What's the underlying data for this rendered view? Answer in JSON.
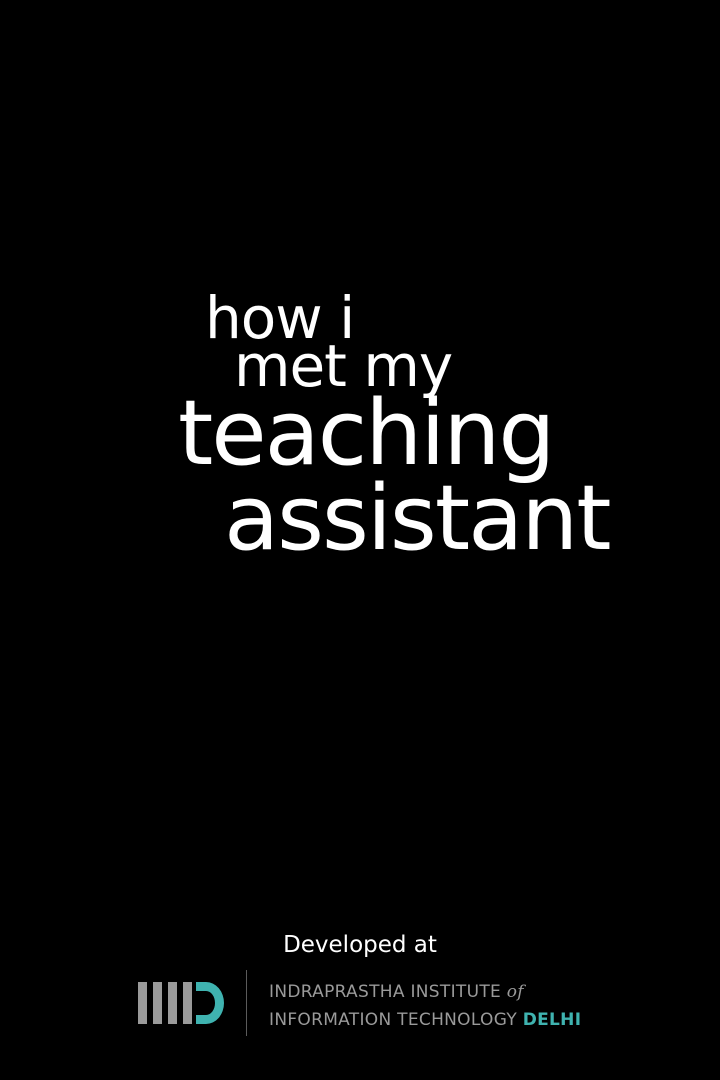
{
  "title": {
    "line1": "how i",
    "line2": "met my",
    "line3": "teaching",
    "line4": "assistant"
  },
  "footer": {
    "developed_at": "Developed at",
    "institute": {
      "line1_main": "INDRAPRASTHA INSTITUTE ",
      "line1_italic": "of",
      "line2_main": "INFORMATION TECHNOLOGY ",
      "line2_accent": "DELHI"
    }
  },
  "colors": {
    "background": "#000000",
    "title_text": "#ffffff",
    "logo_gray": "#9a9a9a",
    "logo_accent": "#3fb3b0"
  },
  "icons": {
    "logo": "iiitd-logo-icon"
  }
}
